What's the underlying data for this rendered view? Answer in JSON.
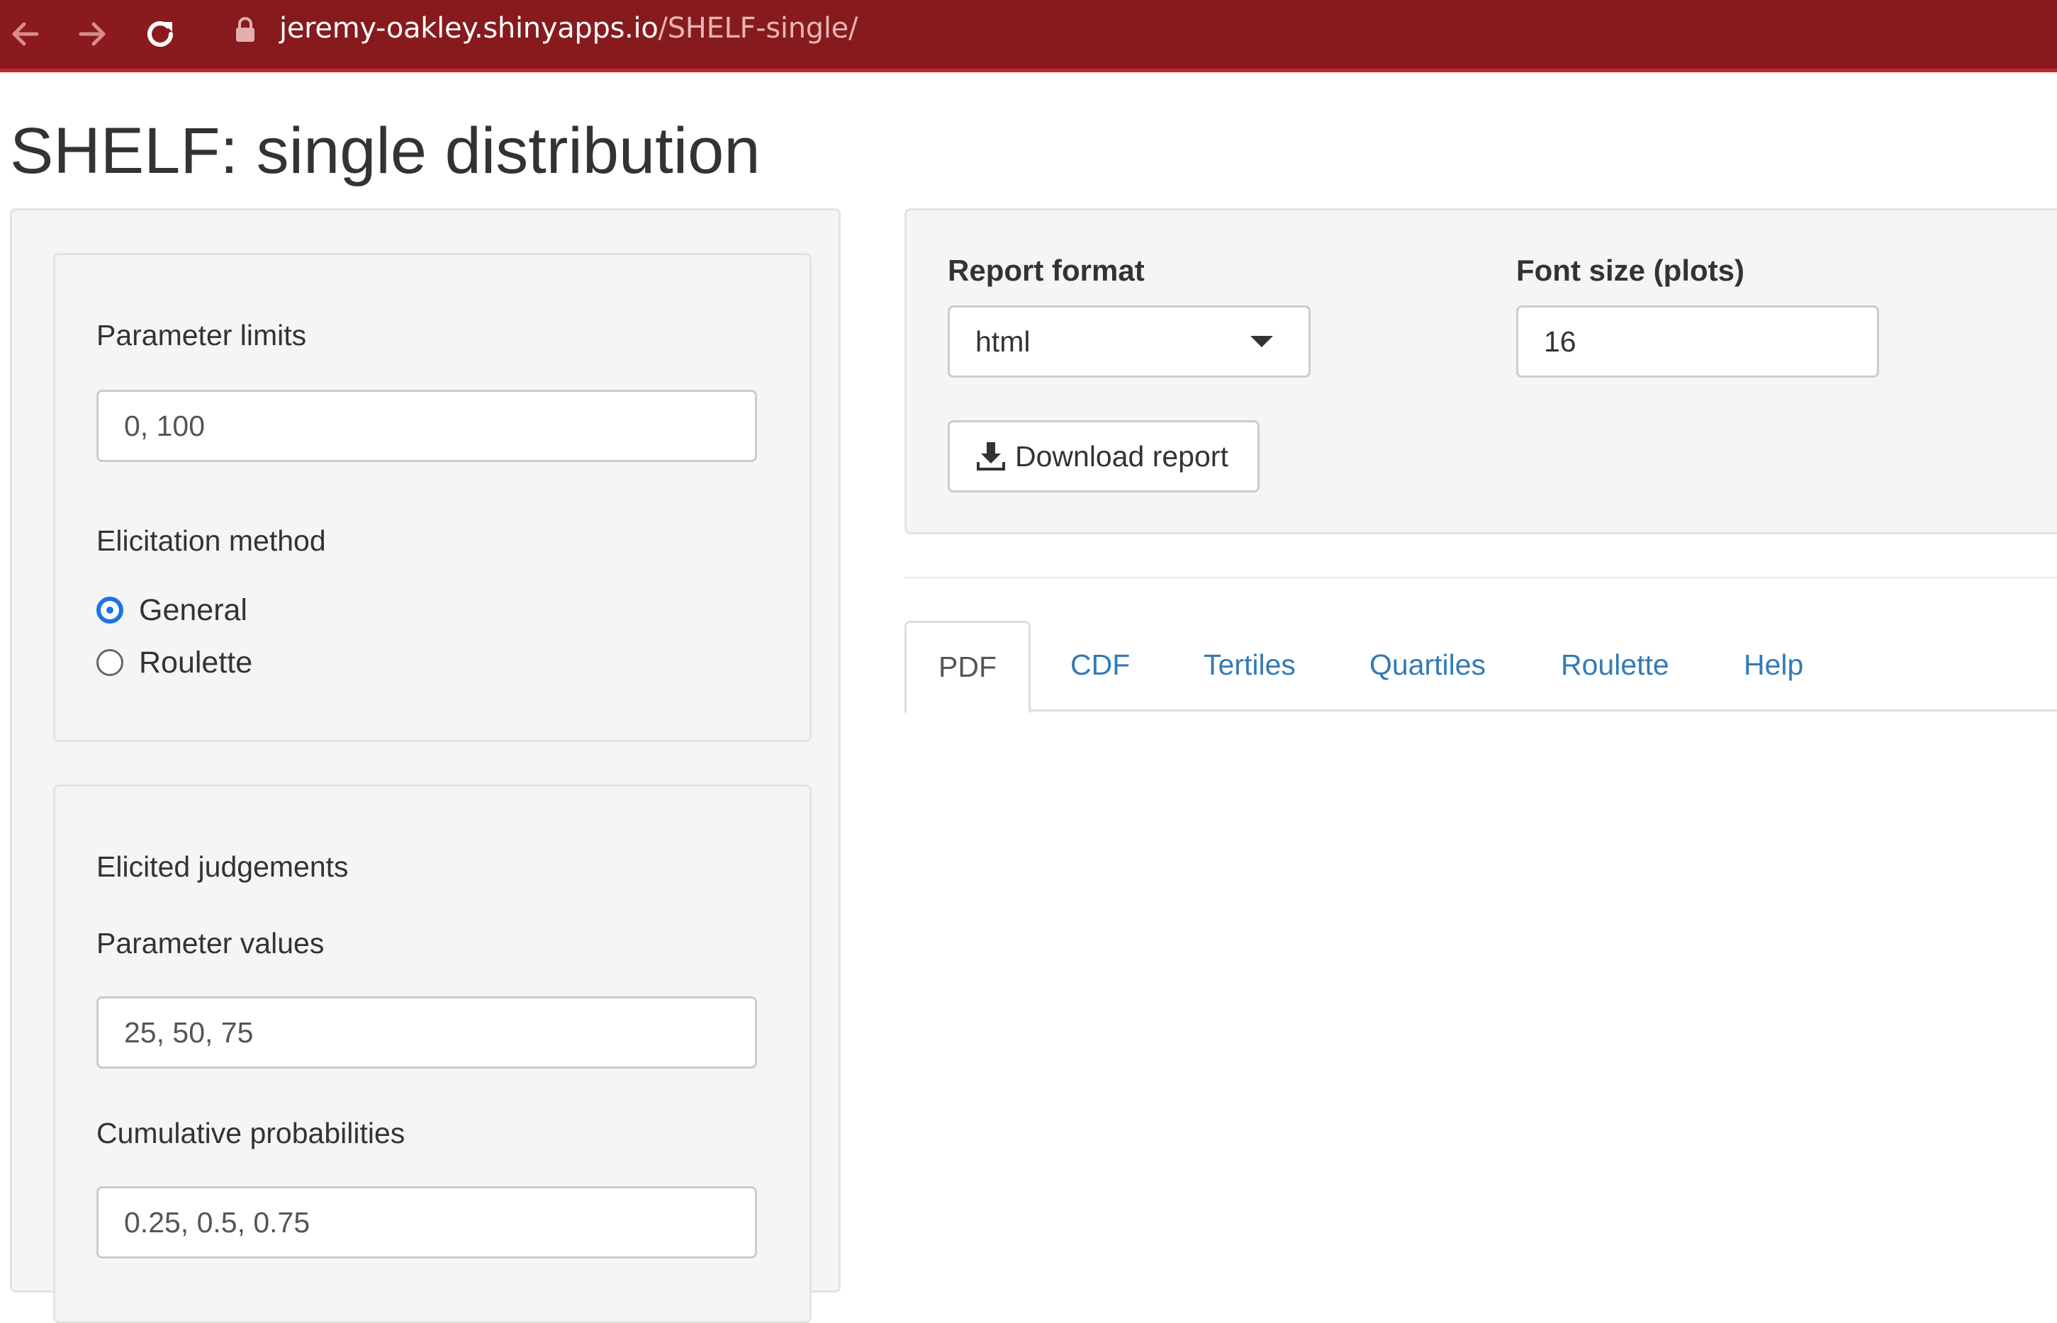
{
  "browser": {
    "url_host": "jeremy-oakley.shinyapps.io",
    "url_path": "/SHELF-single/",
    "icons": [
      "back-arrow-icon",
      "forward-arrow-icon",
      "reload-icon",
      "lock-icon"
    ]
  },
  "page": {
    "title": "SHELF: single distribution"
  },
  "sidebar": {
    "parameter_limits_label": "Parameter limits",
    "parameter_limits_value": "0, 100",
    "elicitation_method_label": "Elicitation method",
    "methods": [
      {
        "label": "General",
        "checked": true
      },
      {
        "label": "Roulette",
        "checked": false
      }
    ],
    "elicited_judgements_label": "Elicited judgements",
    "parameter_values_label": "Parameter values",
    "parameter_values_value": "25, 50, 75",
    "cumulative_probabilities_label": "Cumulative probabilities",
    "cumulative_probabilities_value": "0.25, 0.5, 0.75"
  },
  "report": {
    "format_label": "Report format",
    "format_value": "html",
    "font_size_label": "Font size (plots)",
    "font_size_value": "16",
    "download_label": "Download report"
  },
  "tabs": [
    {
      "label": "PDF",
      "active": true
    },
    {
      "label": "CDF",
      "active": false
    },
    {
      "label": "Tertiles",
      "active": false
    },
    {
      "label": "Quartiles",
      "active": false
    },
    {
      "label": "Roulette",
      "active": false
    },
    {
      "label": "Help",
      "active": false
    }
  ],
  "colors": {
    "browser_bar": "#8b1a1e",
    "link": "#337ab7",
    "radio_checked": "#1a73e8"
  }
}
